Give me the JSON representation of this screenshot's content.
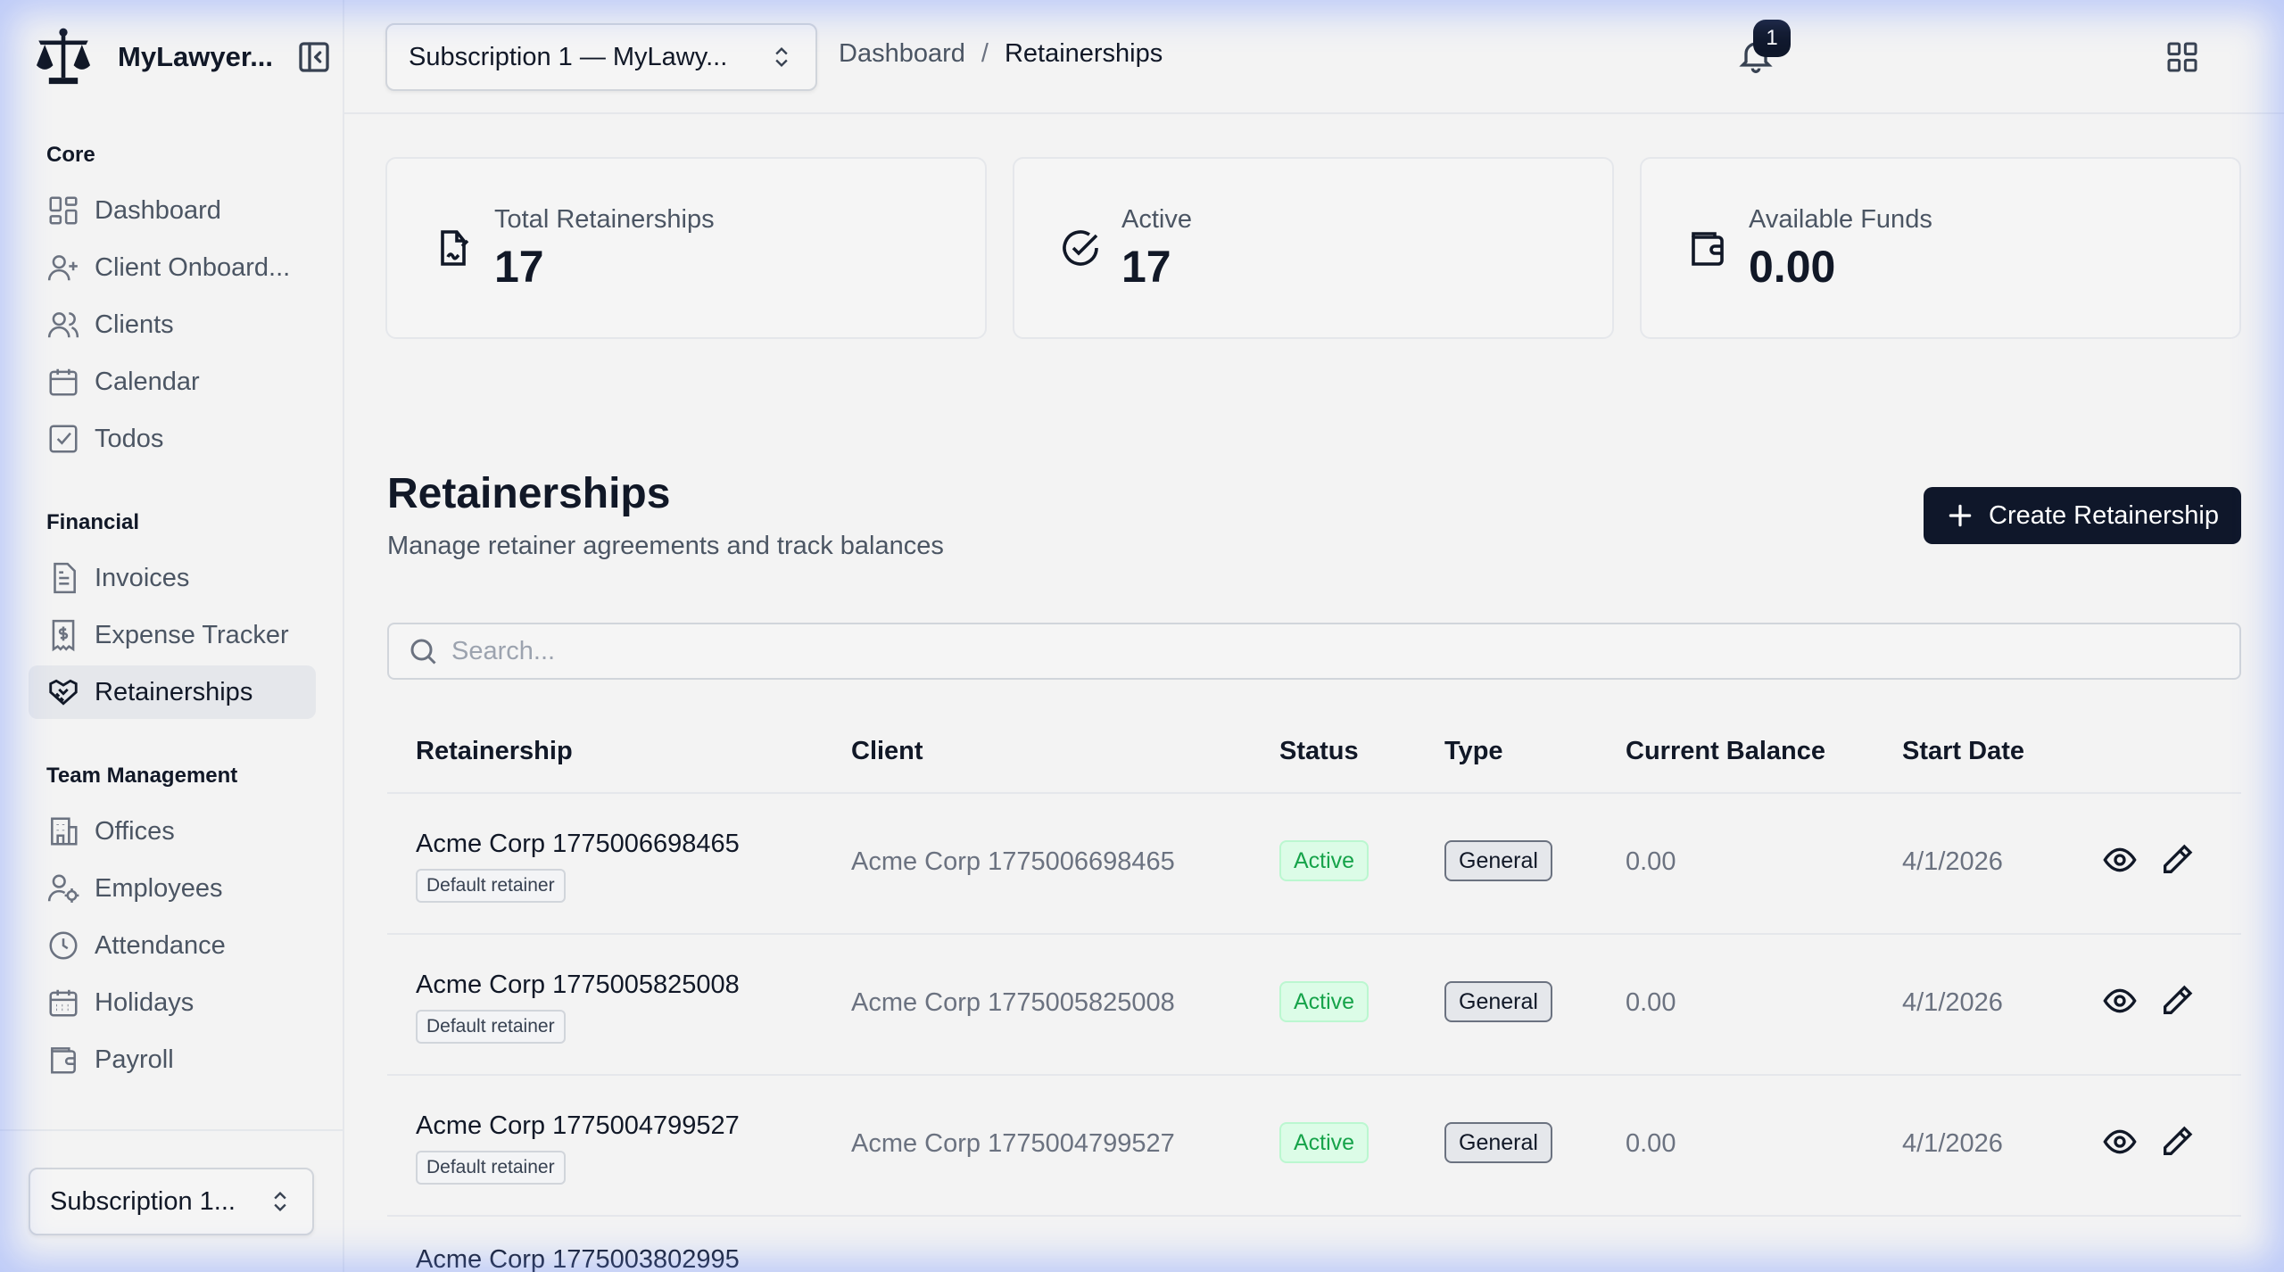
{
  "brand": {
    "name": "MyLawyer..."
  },
  "sidebar": {
    "groups": [
      {
        "title": "Core",
        "items": [
          {
            "label": "Dashboard",
            "icon": "dashboard-icon"
          },
          {
            "label": "Client Onboard...",
            "icon": "user-plus-icon"
          },
          {
            "label": "Clients",
            "icon": "users-icon"
          },
          {
            "label": "Calendar",
            "icon": "calendar-icon"
          },
          {
            "label": "Todos",
            "icon": "checkbox-icon"
          }
        ]
      },
      {
        "title": "Financial",
        "items": [
          {
            "label": "Invoices",
            "icon": "document-icon"
          },
          {
            "label": "Expense Tracker",
            "icon": "receipt-dollar-icon"
          },
          {
            "label": "Retainerships",
            "icon": "handshake-icon",
            "active": true
          }
        ]
      },
      {
        "title": "Team Management",
        "items": [
          {
            "label": "Offices",
            "icon": "building-icon"
          },
          {
            "label": "Employees",
            "icon": "user-gear-icon"
          },
          {
            "label": "Attendance",
            "icon": "clock-icon"
          },
          {
            "label": "Holidays",
            "icon": "calendar-grid-icon"
          },
          {
            "label": "Payroll",
            "icon": "wallet-icon"
          }
        ]
      }
    ],
    "footer_subscription": "Subscription 1..."
  },
  "topbar": {
    "subscription": "Subscription 1 — MyLawy...",
    "breadcrumb": {
      "parent": "Dashboard",
      "separator": "/",
      "current": "Retainerships"
    },
    "notifications_count": "1"
  },
  "stats": [
    {
      "label": "Total Retainerships",
      "value": "17",
      "icon": "file-signature-icon"
    },
    {
      "label": "Active",
      "value": "17",
      "icon": "check-circle-icon"
    },
    {
      "label": "Available Funds",
      "value": "0.00",
      "icon": "wallet-icon"
    }
  ],
  "page": {
    "title": "Retainerships",
    "subtitle": "Manage retainer agreements and track balances",
    "create_label": "Create Retainership",
    "search_placeholder": "Search..."
  },
  "table": {
    "headers": [
      "Retainership",
      "Client",
      "Status",
      "Type",
      "Current Balance",
      "Start Date"
    ],
    "rows": [
      {
        "name": "Acme Corp 1775006698465",
        "tag": "Default retainer",
        "client": "Acme Corp 1775006698465",
        "status": "Active",
        "type": "General",
        "balance": "0.00",
        "start": "4/1/2026"
      },
      {
        "name": "Acme Corp 1775005825008",
        "tag": "Default retainer",
        "client": "Acme Corp 1775005825008",
        "status": "Active",
        "type": "General",
        "balance": "0.00",
        "start": "4/1/2026"
      },
      {
        "name": "Acme Corp 1775004799527",
        "tag": "Default retainer",
        "client": "Acme Corp 1775004799527",
        "status": "Active",
        "type": "General",
        "balance": "0.00",
        "start": "4/1/2026"
      }
    ],
    "partial_row_name": "Acme Corp 1775003802995"
  },
  "colors": {
    "primary": "#0f172a",
    "active_green": "#16a34a",
    "border": "#e5e7eb"
  }
}
